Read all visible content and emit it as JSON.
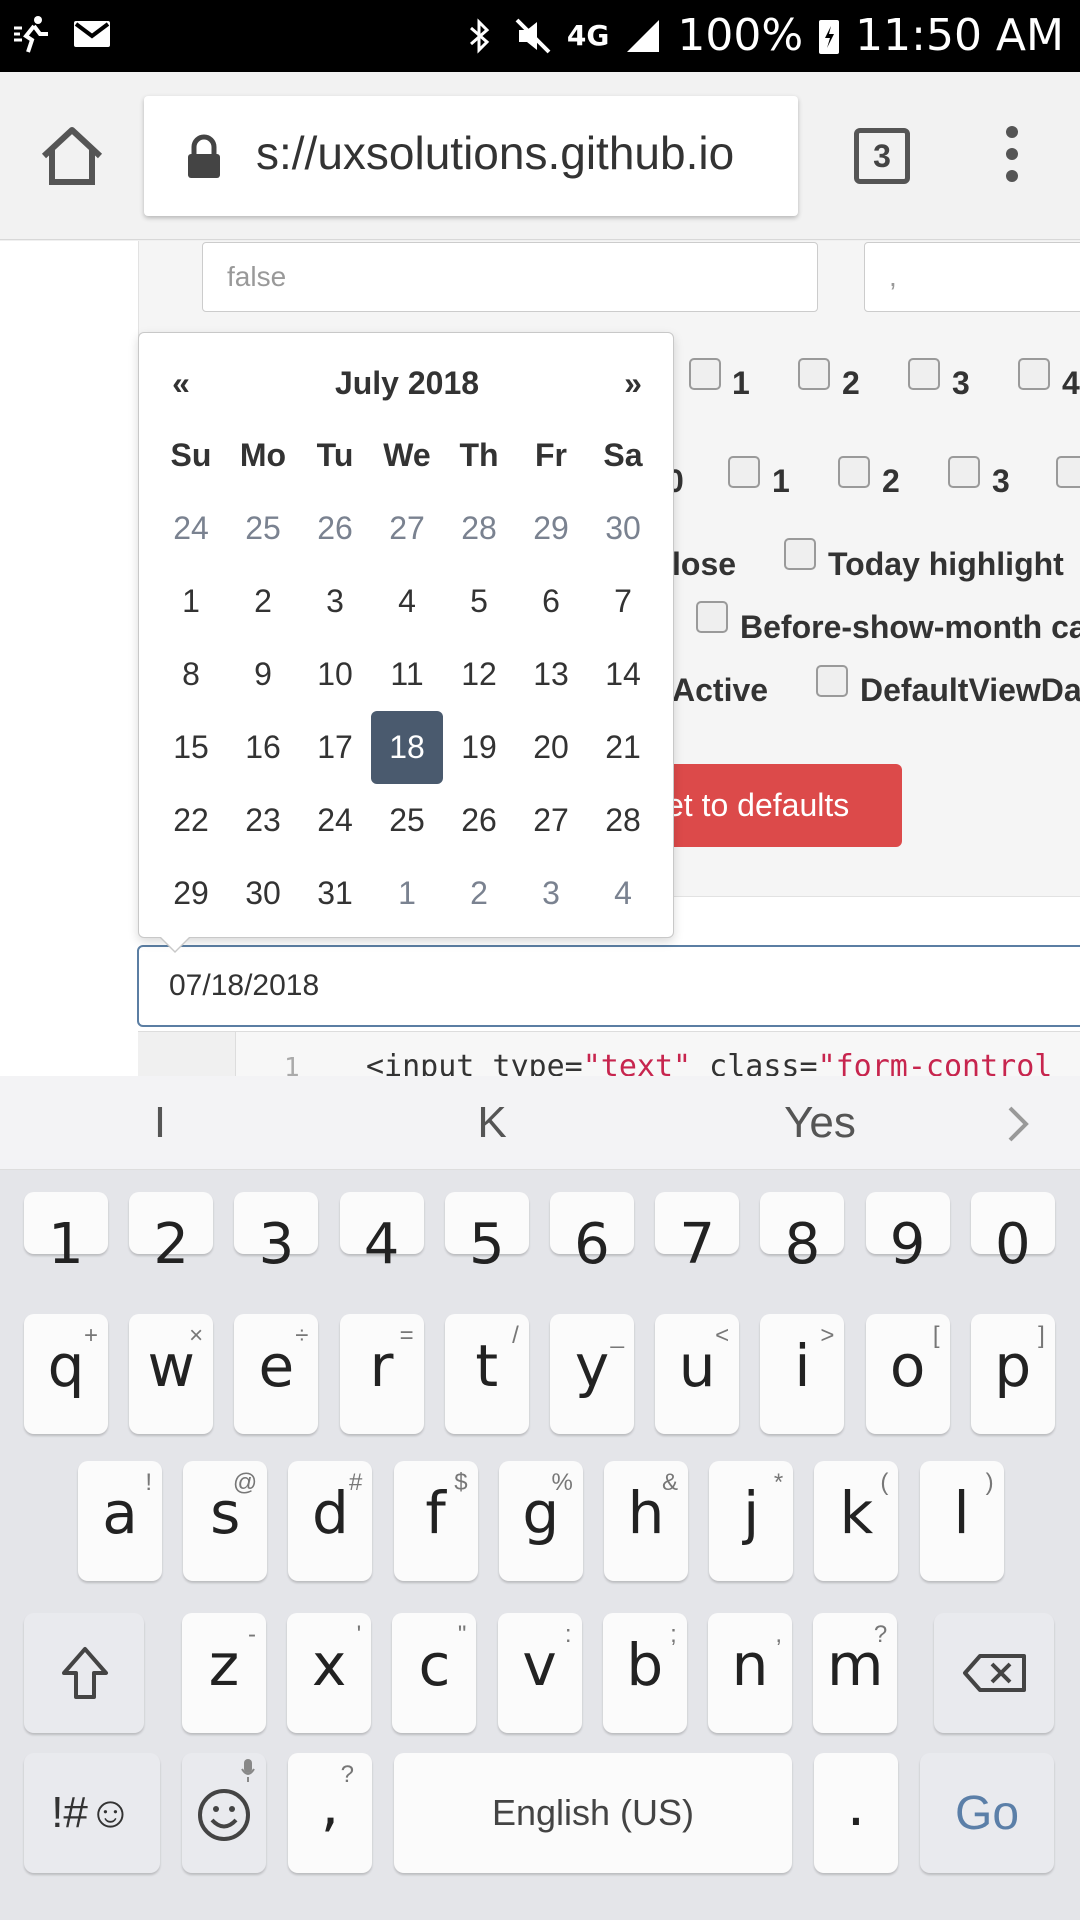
{
  "status_bar": {
    "network": "4G",
    "battery": "100%",
    "time": "11:50 AM"
  },
  "browser": {
    "url": "s://uxsolutions.github.io",
    "tab_count": "3"
  },
  "page": {
    "input_false_value": "false",
    "input_comma_value": ",",
    "checkbox_row1": [
      "1",
      "2",
      "3",
      "4"
    ],
    "checkbox_row2_partial": "0",
    "checkbox_row2": [
      "1",
      "2",
      "3"
    ],
    "opt_close": "lose",
    "opt_today_highlight": "Today highlight",
    "opt_before_show_month": "Before-show-month ca",
    "opt_active": "Active",
    "opt_default_view_date": "DefaultViewDa",
    "reset_button": "et to defaults",
    "date_input_value": "07/18/2018",
    "code_line_no": "1",
    "code_prefix": "<input type=",
    "code_str1": "\"text\"",
    "code_mid": " class=",
    "code_str2": "\"form-control"
  },
  "datepicker": {
    "prev": "«",
    "next": "»",
    "title": "July 2018",
    "weekdays": [
      "Su",
      "Mo",
      "Tu",
      "We",
      "Th",
      "Fr",
      "Sa"
    ],
    "weeks": [
      [
        "24",
        "25",
        "26",
        "27",
        "28",
        "29",
        "30"
      ],
      [
        "1",
        "2",
        "3",
        "4",
        "5",
        "6",
        "7"
      ],
      [
        "8",
        "9",
        "10",
        "11",
        "12",
        "13",
        "14"
      ],
      [
        "15",
        "16",
        "17",
        "18",
        "19",
        "20",
        "21"
      ],
      [
        "22",
        "23",
        "24",
        "25",
        "26",
        "27",
        "28"
      ],
      [
        "29",
        "30",
        "31",
        "1",
        "2",
        "3",
        "4"
      ]
    ],
    "selected": "18"
  },
  "keyboard": {
    "suggestions": [
      "I",
      "K",
      "Yes"
    ],
    "numbers": [
      "1",
      "2",
      "3",
      "4",
      "5",
      "6",
      "7",
      "8",
      "9",
      "0"
    ],
    "row1": [
      "q",
      "w",
      "e",
      "r",
      "t",
      "y",
      "u",
      "i",
      "o",
      "p"
    ],
    "row1_sub": [
      "+",
      "×",
      "÷",
      "=",
      "/",
      "_",
      "<",
      ">",
      "[",
      "]"
    ],
    "row2": [
      "a",
      "s",
      "d",
      "f",
      "g",
      "h",
      "j",
      "k",
      "l"
    ],
    "row2_sub": [
      "!",
      "@",
      "#",
      "$",
      "%",
      "&",
      "*",
      "(",
      ")"
    ],
    "row3": [
      "z",
      "x",
      "c",
      "v",
      "b",
      "n",
      "m"
    ],
    "row3_sub": [
      "-",
      "'",
      "\"",
      ":",
      ";",
      ",",
      "?"
    ],
    "symbols_key": "!#☺",
    "comma_key": ",",
    "comma_sub": "?",
    "space_key": "English (US)",
    "period_key": ".",
    "go_key": "Go"
  }
}
